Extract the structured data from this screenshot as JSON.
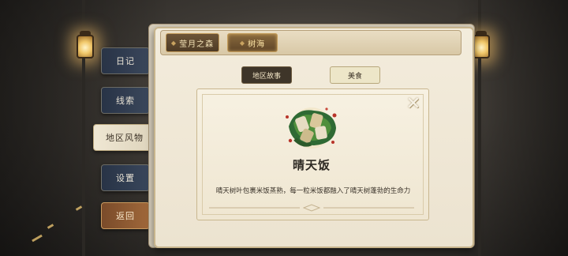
{
  "breadcrumb": [
    "莹月之森",
    "树海"
  ],
  "nav": {
    "items": [
      "日记",
      "线索",
      "地区风物",
      "设置",
      "返回"
    ],
    "active": "地区风物"
  },
  "tabs": [
    "地区故事",
    "美食"
  ],
  "active_tab": "美食",
  "detail": {
    "name": "晴天饭",
    "description": "晴天树叶包裹米饭蒸熟，每一粒米饭都融入了晴天树蓬勃的生命力",
    "close_symbol": "✕"
  }
}
